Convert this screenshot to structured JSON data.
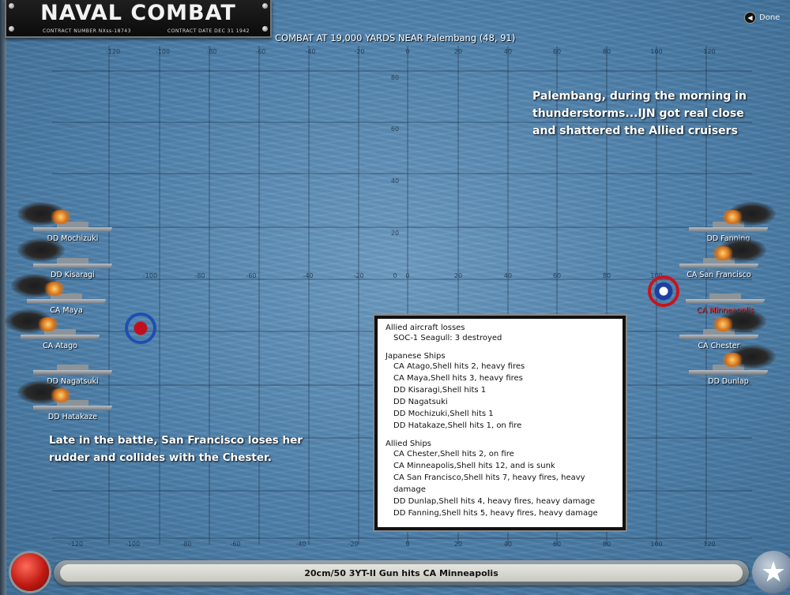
{
  "header": {
    "title": "NAVAL COMBAT",
    "contract_number": "CONTRACT NUMBER NXss-18743",
    "contract_date": "CONTRACT DATE DEC 31 1942",
    "combat_location": "COMBAT AT 19,000 YARDS NEAR Palembang (48, 91)",
    "done_label": "Done"
  },
  "grid": {
    "top_ticks": [
      "-120",
      "-100",
      "-80",
      "-60",
      "-40",
      "-20",
      "0",
      "20",
      "40",
      "60",
      "80",
      "100",
      "120"
    ],
    "mid_ticks": [
      "-100",
      "-80",
      "-60",
      "-40",
      "-20",
      "0",
      "20",
      "40",
      "60",
      "80",
      "100"
    ],
    "bottom_ticks": [
      "-120",
      "-100",
      "-80",
      "-60",
      "-40",
      "-20",
      "0",
      "20",
      "40",
      "60",
      "80",
      "100",
      "120"
    ],
    "y_ticks": [
      "80",
      "60",
      "40",
      "20",
      "0"
    ]
  },
  "notes": {
    "top": "Palembang, during the morning in thunderstorms...IJN got real close and shattered the Allied cruisers",
    "bottom": "Late in the battle, San Francisco loses her rudder and collides with the Chester."
  },
  "ships": {
    "japanese": [
      {
        "label": "DD Mochizuki",
        "state": "fire"
      },
      {
        "label": "DD Kisaragi",
        "state": "smoke"
      },
      {
        "label": "CA Maya",
        "state": "fire"
      },
      {
        "label": "CA Atago",
        "state": "fire"
      },
      {
        "label": "DD Nagatsuki",
        "state": "ok"
      },
      {
        "label": "DD Hatakaze",
        "state": "fire"
      }
    ],
    "allied": [
      {
        "label": "DD Fanning",
        "state": "fire"
      },
      {
        "label": "CA San Francisco",
        "state": "fire"
      },
      {
        "label": "CA Minneapolis",
        "state": "sunk"
      },
      {
        "label": "CA Chester",
        "state": "fire"
      },
      {
        "label": "DD Dunlap",
        "state": "fire"
      }
    ]
  },
  "report": {
    "aircraft_header": "Allied aircraft losses",
    "aircraft": [
      "SOC-1 Seagull: 3 destroyed"
    ],
    "japanese_header": "Japanese Ships",
    "japanese": [
      "CA Atago,Shell hits 2, heavy fires",
      "CA Maya,Shell hits 3, heavy fires",
      "DD Kisaragi,Shell hits 1",
      "DD Nagatsuki",
      "DD Mochizuki,Shell hits 1",
      "DD Hatakaze,Shell hits 1, on fire"
    ],
    "allied_header": "Allied Ships",
    "allied": [
      "CA Chester,Shell hits 2, on fire",
      "CA Minneapolis,Shell hits 12, and is sunk",
      "CA San Francisco,Shell hits 7, heavy fires, heavy damage",
      "DD Dunlap,Shell hits 4, heavy fires, heavy damage",
      "DD Fanning,Shell hits 5, heavy fires, heavy damage"
    ]
  },
  "status_bar": {
    "message": "20cm/50 3YT-II Gun hits CA Minneapolis"
  },
  "colors": {
    "sea": "#4f82ad",
    "sunk_label": "#e33333",
    "target_red": "#c8141c",
    "target_blue": "#1d4fb3"
  },
  "icons": {
    "done": "done-icon",
    "red_button": "red-action-button",
    "star": "allied-star-icon"
  }
}
